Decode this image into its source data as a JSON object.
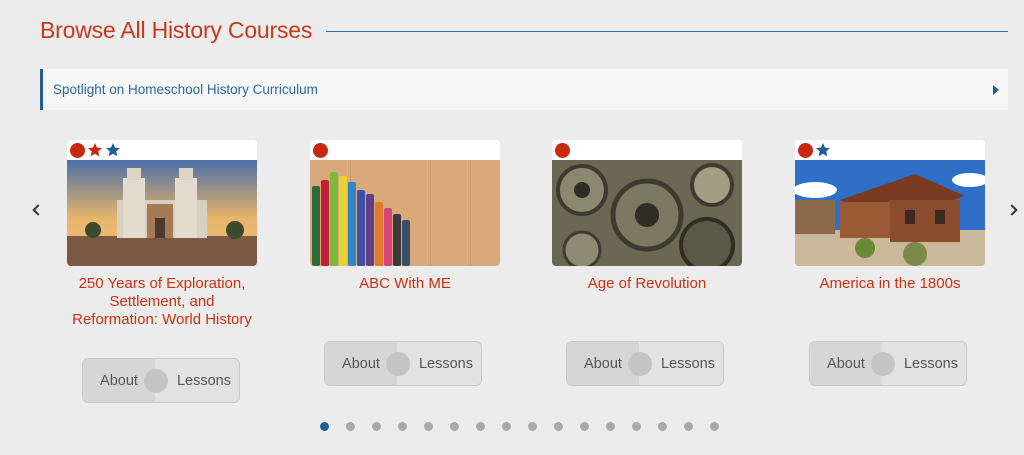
{
  "header": {
    "title": "Browse All History Courses"
  },
  "spotlight": {
    "label": "Spotlight on Homeschool History Curriculum"
  },
  "carousel": {
    "prev_icon": "chevron-left-icon",
    "next_icon": "chevron-right-icon",
    "courses": [
      {
        "title": "250 Years of Exploration, Settlement, and Reformation: World History",
        "badges": [
          "red-dot",
          "red-star",
          "blue-star"
        ],
        "about_label": "About",
        "lessons_label": "Lessons"
      },
      {
        "title": "ABC With ME",
        "badges": [
          "red-dot"
        ],
        "about_label": "About",
        "lessons_label": "Lessons"
      },
      {
        "title": "Age of Revolution",
        "badges": [
          "red-dot"
        ],
        "about_label": "About",
        "lessons_label": "Lessons"
      },
      {
        "title": "America in the 1800s",
        "badges": [
          "red-dot",
          "blue-star"
        ],
        "about_label": "About",
        "lessons_label": "Lessons"
      }
    ],
    "pages": 16,
    "active_page": 1
  },
  "colors": {
    "accent_red": "#c8391c",
    "accent_blue": "#1f5f96"
  }
}
